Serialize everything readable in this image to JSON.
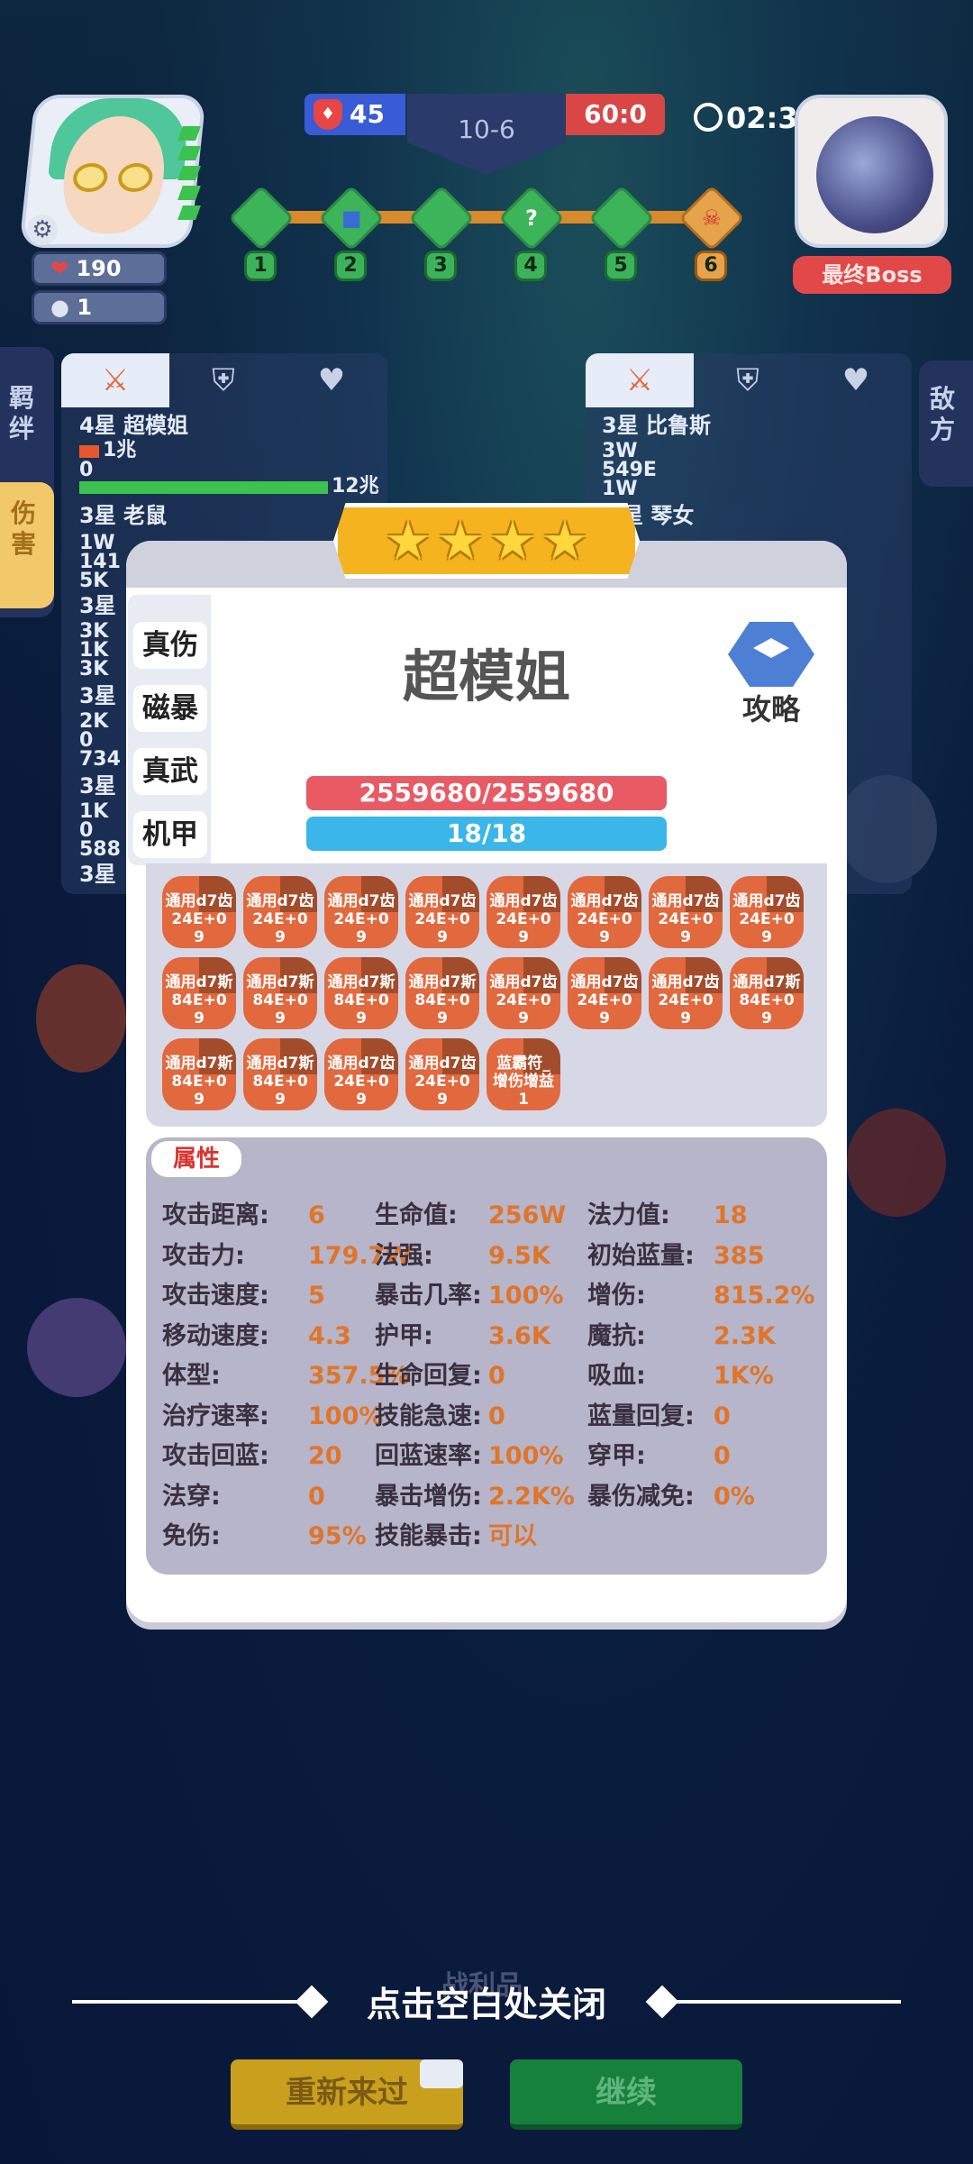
{
  "top": {
    "player_hp": "190",
    "player_coins": "1",
    "left_score": "45",
    "round": "10-6",
    "right_score": "60:0",
    "timer": "02:3",
    "boss_label": "最终Boss",
    "stages": [
      "1",
      "2",
      "3",
      "4",
      "5",
      "6"
    ]
  },
  "left_panel": {
    "side_tab_top": "羁绊",
    "side_tab_bottom": "伤害",
    "unit1_title": "4星 超模姐",
    "unit1_a": "1兆",
    "unit1_b": "0",
    "unit1_c": "12兆",
    "unit2_title": "3星 老鼠",
    "unit2_vals": "1W\n141\n5K",
    "unit3_title": "3星",
    "unit3_vals": "3K\n1K\n3K",
    "unit4_title": "3星",
    "unit4_vals": "2K\n0\n734",
    "unit5_title": "3星",
    "unit5_vals": "1K\n0\n588",
    "unit6_title": "3星"
  },
  "right_panel": {
    "enemy_tab": "敌方",
    "unit1_title": "3星 比鲁斯",
    "unit1_vals": "3W\n549E\n1W",
    "unit2_title": "星 琴女"
  },
  "modal": {
    "stars": 4,
    "categories": [
      "真伤",
      "磁暴",
      "真武",
      "机甲"
    ],
    "hero_name": "超模姐",
    "guide_label": "攻略",
    "hp_text": "2559680/2559680",
    "mp_text": "18/18",
    "items": [
      {
        "l1": "通用d7齿",
        "l2": "24E+0",
        "l3": "9"
      },
      {
        "l1": "通用d7齿",
        "l2": "24E+0",
        "l3": "9"
      },
      {
        "l1": "通用d7齿",
        "l2": "24E+0",
        "l3": "9"
      },
      {
        "l1": "通用d7齿",
        "l2": "24E+0",
        "l3": "9"
      },
      {
        "l1": "通用d7齿",
        "l2": "24E+0",
        "l3": "9"
      },
      {
        "l1": "通用d7齿",
        "l2": "24E+0",
        "l3": "9"
      },
      {
        "l1": "通用d7齿",
        "l2": "24E+0",
        "l3": "9"
      },
      {
        "l1": "通用d7齿",
        "l2": "24E+0",
        "l3": "9"
      },
      {
        "l1": "通用d7斯",
        "l2": "84E+0",
        "l3": "9"
      },
      {
        "l1": "通用d7斯",
        "l2": "84E+0",
        "l3": "9"
      },
      {
        "l1": "通用d7斯",
        "l2": "84E+0",
        "l3": "9"
      },
      {
        "l1": "通用d7斯",
        "l2": "84E+0",
        "l3": "9"
      },
      {
        "l1": "通用d7齿",
        "l2": "24E+0",
        "l3": "9"
      },
      {
        "l1": "通用d7齿",
        "l2": "24E+0",
        "l3": "9"
      },
      {
        "l1": "通用d7齿",
        "l2": "24E+0",
        "l3": "9"
      },
      {
        "l1": "通用d7斯",
        "l2": "84E+0",
        "l3": "9"
      },
      {
        "l1": "通用d7斯",
        "l2": "84E+0",
        "l3": "9"
      },
      {
        "l1": "通用d7斯",
        "l2": "84E+0",
        "l3": "9"
      },
      {
        "l1": "通用d7齿",
        "l2": "24E+0",
        "l3": "9"
      },
      {
        "l1": "通用d7齿",
        "l2": "24E+0",
        "l3": "9"
      },
      {
        "l1": "蓝霸符_",
        "l2": "增伤增益",
        "l3": "1"
      }
    ],
    "attr_title": "属性",
    "attrs": [
      [
        {
          "k": "攻击距离:",
          "v": "6"
        },
        {
          "k": "生命值:",
          "v": "256W"
        },
        {
          "k": "法力值:",
          "v": "18"
        }
      ],
      [
        {
          "k": "攻击力:",
          "v": "179.7W"
        },
        {
          "k": "法强:",
          "v": "9.5K"
        },
        {
          "k": "初始蓝量:",
          "v": "385"
        }
      ],
      [
        {
          "k": "攻击速度:",
          "v": "5"
        },
        {
          "k": "暴击几率:",
          "v": "100%"
        },
        {
          "k": "增伤:",
          "v": "815.2%"
        }
      ],
      [
        {
          "k": "移动速度:",
          "v": "4.3"
        },
        {
          "k": "护甲:",
          "v": "3.6K"
        },
        {
          "k": "魔抗:",
          "v": "2.3K"
        }
      ],
      [
        {
          "k": "体型:",
          "v": "357.5%"
        },
        {
          "k": "生命回复:",
          "v": "0"
        },
        {
          "k": "吸血:",
          "v": "1K%"
        }
      ],
      [
        {
          "k": "治疗速率:",
          "v": "100%"
        },
        {
          "k": "技能急速:",
          "v": "0"
        },
        {
          "k": "蓝量回复:",
          "v": "0"
        }
      ],
      [
        {
          "k": "攻击回蓝:",
          "v": "20"
        },
        {
          "k": "回蓝速率:",
          "v": "100%"
        },
        {
          "k": "穿甲:",
          "v": "0"
        }
      ],
      [
        {
          "k": "法穿:",
          "v": "0"
        },
        {
          "k": "暴击增伤:",
          "v": "2.2K%"
        },
        {
          "k": "暴伤减免:",
          "v": "0%"
        }
      ],
      [
        {
          "k": "免伤:",
          "v": "95%"
        },
        {
          "k": "技能暴击:",
          "v": "可以"
        }
      ]
    ]
  },
  "bottom": {
    "loot_label": "战利品",
    "close_tip": "点击空白处关闭",
    "retry_label": "重新来过",
    "continue_label": "继续"
  }
}
